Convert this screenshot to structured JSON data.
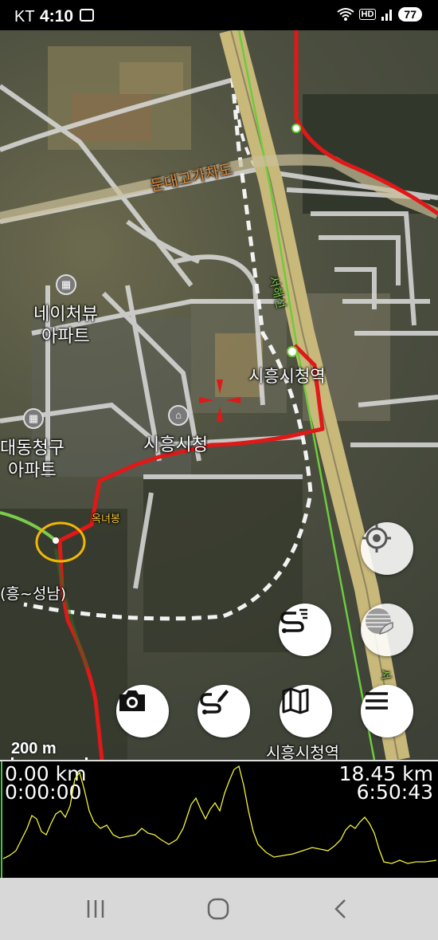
{
  "status": {
    "carrier": "KT",
    "time": "4:10",
    "hd": "HD",
    "battery": "77"
  },
  "map": {
    "labels": {
      "road_dunde": "둔대고가차도",
      "line_seohae": "서해선",
      "station_city_hall": "시흥시청역",
      "station_city_hall_bottom": "시흥시청역",
      "apt_nature_1": "네이처뷰",
      "apt_nature_2": "아파트",
      "apt_daedong_1": "대동청구",
      "apt_daedong_2": "아파트",
      "city_hall": "시흥시청",
      "peak": "옥녀봉",
      "road_side": "(흥~성남)",
      "line_side": "서"
    },
    "scale_label": "200 m",
    "colors": {
      "track": "#e01818",
      "highlight_circle": "#f2b705",
      "rail": "#c8b87a"
    }
  },
  "buttons": {
    "my_location": "crosshair-locate-icon",
    "map_style": "layers-curl-icon",
    "route_list": "route-list-icon",
    "camera": "camera-icon",
    "draw_route": "route-edit-icon",
    "map": "folded-map-icon",
    "menu": "hamburger-menu-icon"
  },
  "profile": {
    "start_distance": "0.00 km",
    "start_time": "0:00:00",
    "total_distance": "18.45 km",
    "total_time": "6:50:43",
    "line_color": "#f4f23a"
  },
  "navbar": {
    "recents": "recents-icon",
    "home": "home-icon",
    "back": "back-chevron-icon"
  }
}
